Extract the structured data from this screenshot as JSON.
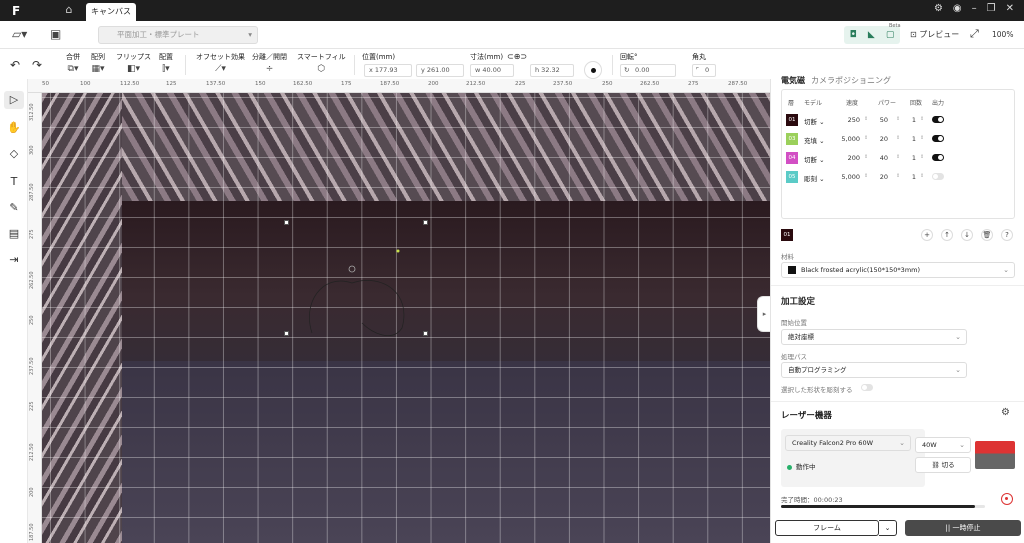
{
  "titlebar": {
    "logo": "F",
    "home_icon": "home-icon",
    "canvas_tab": "キャンバス",
    "icons": [
      "gear-icon",
      "account-icon",
      "minimize-icon",
      "restore-icon",
      "close-icon"
    ]
  },
  "topbar": {
    "mode_select": "平面加工・標準プレート",
    "beta": "Beta",
    "preview": "プレビュー",
    "zoom": "100%"
  },
  "toolbar": {
    "combine": "合併",
    "array": "配列",
    "flip": "フリップス",
    "align": "配置",
    "offset": "オフセット効果",
    "split": "分離／開閉",
    "smart_fill": "スマートフィル",
    "position_label": "位置(mm)",
    "pos_x": "x 177.93",
    "pos_y": "y 261.00",
    "size_label": "寸法(mm)",
    "size_w": "w 40.00",
    "size_h": "h 32.32",
    "rotation_label": "回転°",
    "rotation": "0.00",
    "corner_label": "角丸",
    "corner": "0"
  },
  "ruler": {
    "top": [
      "50",
      "100",
      "112.50",
      "125",
      "137.50",
      "150",
      "162.50",
      "175",
      "187.50",
      "200",
      "212.50",
      "225",
      "237.50",
      "250",
      "262.50",
      "275",
      "287.50"
    ],
    "left": [
      "312.50",
      "300",
      "287.50",
      "275",
      "262.50",
      "250",
      "237.50",
      "225",
      "212.50",
      "200",
      "187.50"
    ]
  },
  "right_panel": {
    "tab_active": "電気磁",
    "tab_other": "カメラポジショニング",
    "layer_headers": [
      "層",
      "モデル",
      "速度",
      "パワー",
      "回数",
      "出力"
    ],
    "layers": [
      {
        "id": "01",
        "color": "#2a0a0e",
        "mode": "切断",
        "speed": "250",
        "power": "50",
        "passes": "1",
        "on": true
      },
      {
        "id": "03",
        "color": "#9bd05b",
        "mode": "充填",
        "speed": "5,000",
        "power": "20",
        "passes": "1",
        "on": true
      },
      {
        "id": "04",
        "color": "#d24fc4",
        "mode": "切断",
        "speed": "200",
        "power": "40",
        "passes": "1",
        "on": true
      },
      {
        "id": "05",
        "color": "#5bcbc7",
        "mode": "彫刻",
        "speed": "5,000",
        "power": "20",
        "passes": "1",
        "on": false
      }
    ],
    "selected_layer": "01",
    "material_label": "材料",
    "material": "Black frosted acrylic(150*150*3mm)",
    "process_title": "加工設定",
    "start_label": "開始位置",
    "start_value": "絶対座標",
    "path_label": "処理パス",
    "path_value": "自動プログラミング",
    "cut_selected": "選択した形状を彫刻する",
    "laser_title": "レーザー機器",
    "machine": "Creality Falcon2 Pro 60W",
    "power_option": "40W",
    "status": "動作中",
    "disconnect": "切る",
    "completion": "完了時間：00:00:23",
    "progress": 0.95,
    "frame_btn": "フレーム",
    "pause_btn": "|| 一時停止"
  }
}
